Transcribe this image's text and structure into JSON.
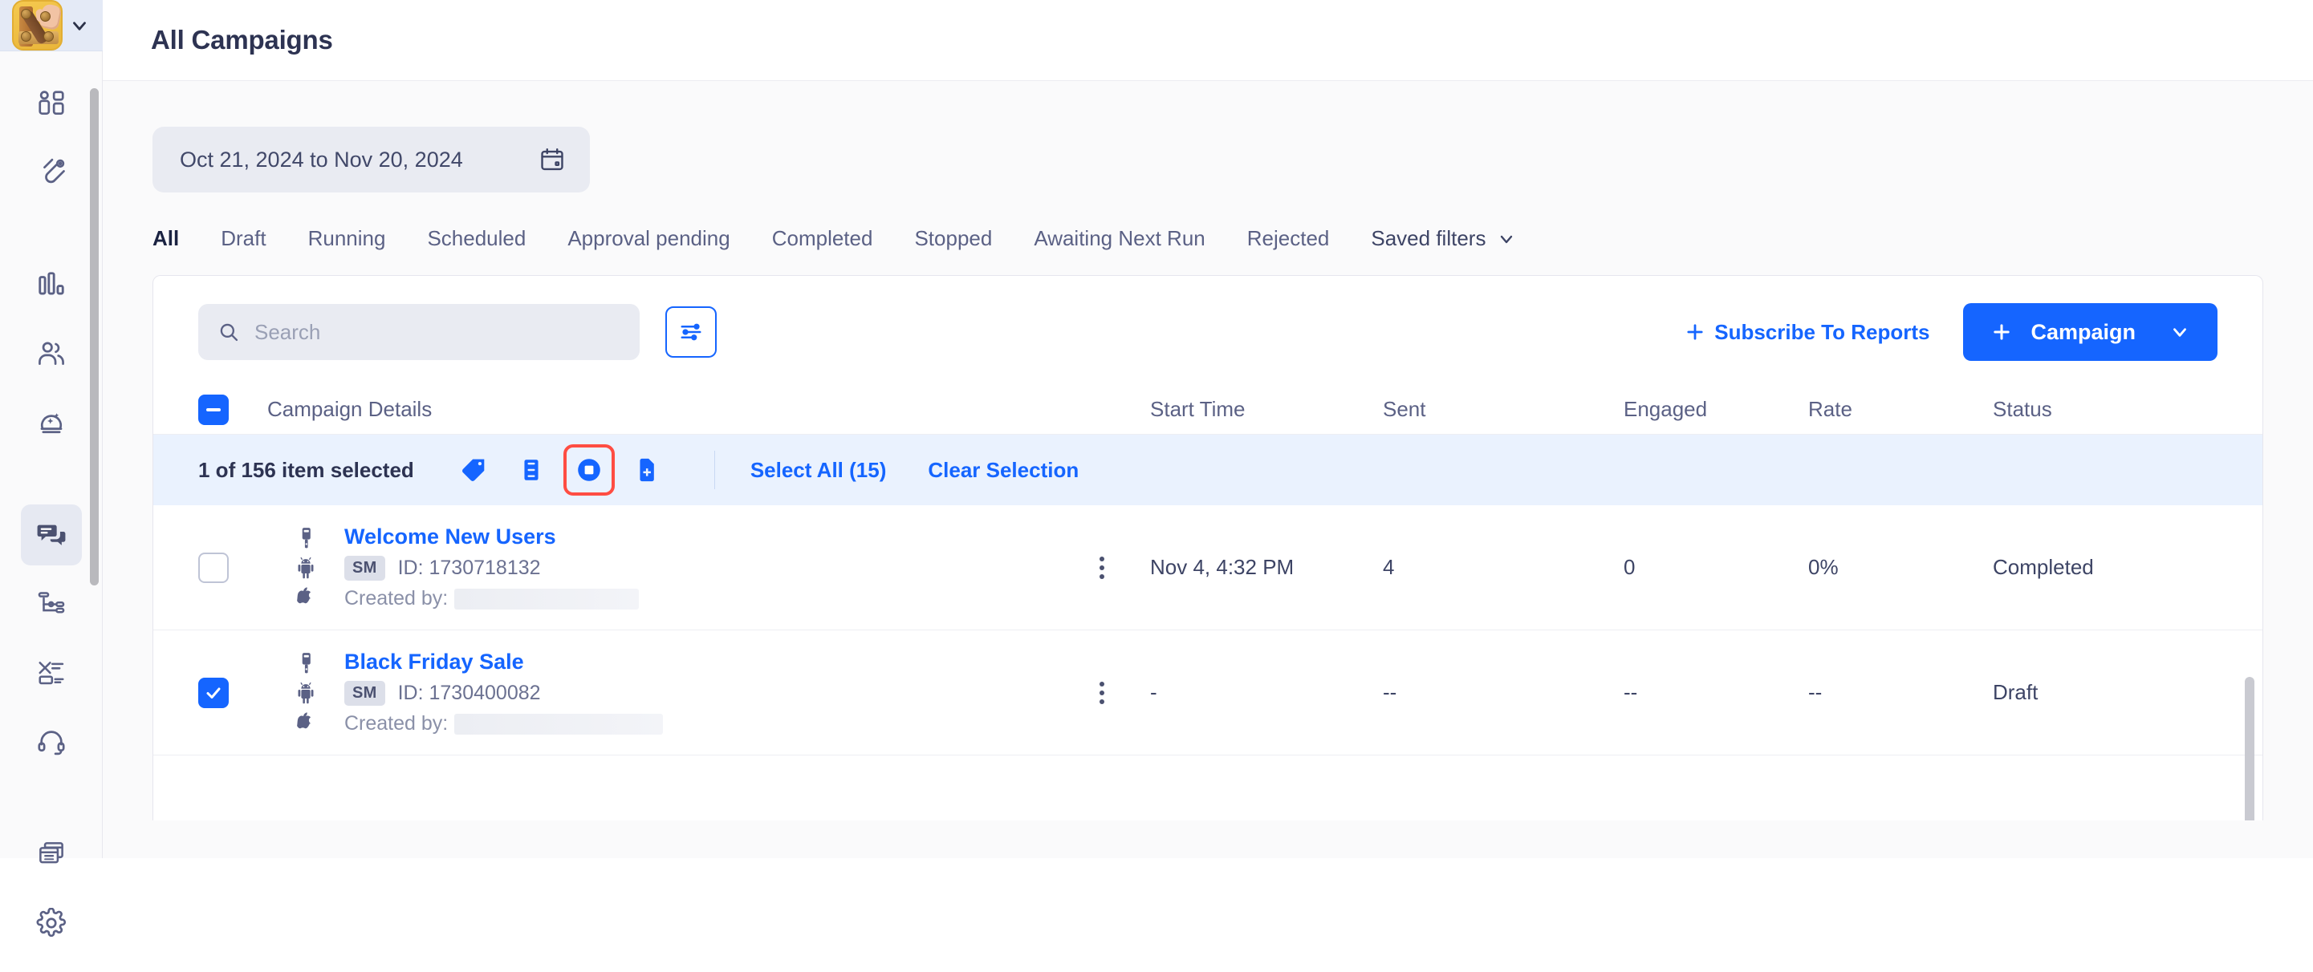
{
  "brand": {
    "app_icon_name": "wood-puzzle-app-icon",
    "chevron": "chevron-down"
  },
  "rail": {
    "items": [
      {
        "name": "dashboard",
        "icon": "dashboard-icon"
      },
      {
        "name": "acquire",
        "icon": "magnet-icon"
      },
      {
        "name": "analytics",
        "icon": "bar-chart-icon"
      },
      {
        "name": "segments",
        "icon": "users-icon"
      },
      {
        "name": "predictions",
        "icon": "crystal-ball-icon"
      },
      {
        "name": "campaigns",
        "icon": "chat-bubbles-icon",
        "active": true
      },
      {
        "name": "journeys",
        "icon": "flow-nodes-icon"
      },
      {
        "name": "experiments",
        "icon": "split-test-icon"
      },
      {
        "name": "support",
        "icon": "headset-icon"
      },
      {
        "name": "templates",
        "icon": "windows-stack-icon"
      },
      {
        "name": "settings",
        "icon": "gear-icon"
      }
    ]
  },
  "header": {
    "title": "All Campaigns"
  },
  "daterange": {
    "value": "Oct 21, 2024 to Nov 20, 2024",
    "icon": "calendar-icon"
  },
  "tabs": [
    {
      "label": "All",
      "active": true
    },
    {
      "label": "Draft",
      "active": false
    },
    {
      "label": "Running",
      "active": false
    },
    {
      "label": "Scheduled",
      "active": false
    },
    {
      "label": "Approval pending",
      "active": false
    },
    {
      "label": "Completed",
      "active": false
    },
    {
      "label": "Stopped",
      "active": false
    },
    {
      "label": "Awaiting Next Run",
      "active": false
    },
    {
      "label": "Rejected",
      "active": false
    }
  ],
  "saved_filters": {
    "label": "Saved filters",
    "icon": "chevron-down-icon"
  },
  "search": {
    "placeholder": "Search",
    "value": "",
    "icon": "search-icon"
  },
  "filter_button": {
    "icon": "sliders-icon"
  },
  "subscribe": {
    "label": "Subscribe To Reports",
    "icon": "plus-icon"
  },
  "campaign_button": {
    "label": "Campaign",
    "icon": "plus-icon",
    "chevron": "chevron-down-icon"
  },
  "table": {
    "header": {
      "select_all_state": "indeterminate",
      "campaign_details": "Campaign Details",
      "start_time": "Start Time",
      "sent": "Sent",
      "engaged": "Engaged",
      "rate": "Rate",
      "status": "Status"
    },
    "selection_bar": {
      "text": "1 of 156 item selected",
      "icons": [
        {
          "name": "tag-icon",
          "highlighted": false
        },
        {
          "name": "archive-box-icon",
          "highlighted": false
        },
        {
          "name": "stop-circle-icon",
          "highlighted": true
        },
        {
          "name": "file-add-icon",
          "highlighted": false
        }
      ],
      "select_all": "Select All (15)",
      "clear_selection": "Clear Selection"
    },
    "rows": [
      {
        "selected": false,
        "channels": [
          "sms-device-icon",
          "android-icon",
          "apple-icon"
        ],
        "name": "Welcome New Users",
        "badge": "SM",
        "id": "ID: 1730718132",
        "created_by": "Created by:",
        "start_time": "Nov 4, 4:32 PM",
        "sent": "4",
        "engaged": "0",
        "rate": "0%",
        "status": "Completed"
      },
      {
        "selected": true,
        "channels": [
          "sms-device-icon",
          "android-icon",
          "apple-icon"
        ],
        "name": "Black Friday Sale",
        "badge": "SM",
        "id": "ID: 1730400082",
        "created_by": "Created by:",
        "start_time": "-",
        "sent": "--",
        "engaged": "--",
        "rate": "--",
        "status": "Draft"
      }
    ]
  },
  "colors": {
    "accent": "#1565ff",
    "highlight": "#ff4d42",
    "text": "#3d4465",
    "rail_bg": "#fafafb",
    "selbar_bg": "#eaf2fe"
  }
}
